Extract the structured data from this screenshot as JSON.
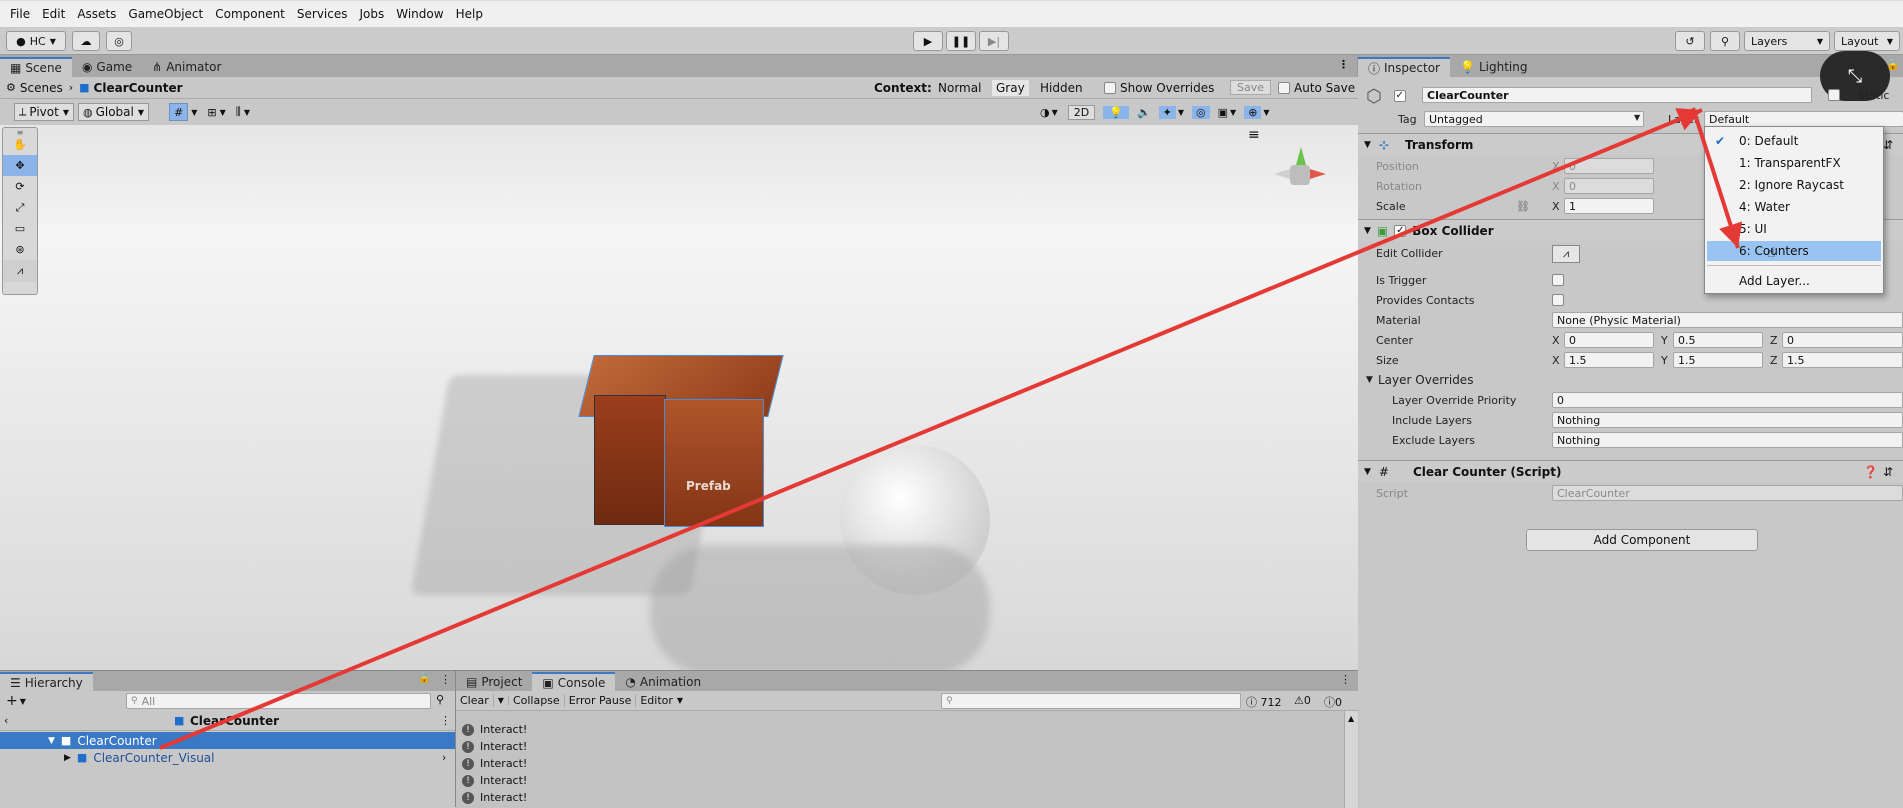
{
  "menu": [
    "File",
    "Edit",
    "Assets",
    "GameObject",
    "Component",
    "Services",
    "Jobs",
    "Window",
    "Help"
  ],
  "toolbar": {
    "account": "HC",
    "layers": "Layers",
    "layout": "Layout"
  },
  "scene_tabs": [
    "Scene",
    "Game",
    "Animator"
  ],
  "breadcrumb": {
    "root": "Scenes",
    "item": "ClearCounter"
  },
  "context_bar": {
    "label": "Context:",
    "normal": "Normal",
    "gray": "Gray",
    "hidden": "Hidden",
    "show_overrides": "Show Overrides",
    "save": "Save",
    "auto_save": "Auto Save"
  },
  "scene_toolbar": {
    "pivot": "Pivot",
    "global": "Global",
    "mode_2d": "2D"
  },
  "scene": {
    "prefab_label": "Prefab"
  },
  "inspector": {
    "tabs": [
      "Inspector",
      "Lighting"
    ],
    "object_name": "ClearCounter",
    "static_label": "Static",
    "tag_label": "Tag",
    "tag_value": "Untagged",
    "layer_label": "Layer",
    "layer_value": "Default",
    "transform": {
      "title": "Transform",
      "position": {
        "label": "Position",
        "x": "0"
      },
      "rotation": {
        "label": "Rotation",
        "x": "0"
      },
      "scale": {
        "label": "Scale",
        "x": "1"
      }
    },
    "box_collider": {
      "title": "Box Collider",
      "edit_collider": "Edit Collider",
      "is_trigger": "Is Trigger",
      "provides_contacts": "Provides Contacts",
      "material_label": "Material",
      "material_value": "None (Physic Material)",
      "center": {
        "label": "Center",
        "x": "0",
        "y": "0.5",
        "z": "0"
      },
      "size": {
        "label": "Size",
        "x": "1.5",
        "y": "1.5",
        "z": "1.5"
      },
      "layer_overrides": "Layer Overrides",
      "priority_label": "Layer Override Priority",
      "priority_value": "0",
      "include_label": "Include Layers",
      "include_value": "Nothing",
      "exclude_label": "Exclude Layers",
      "exclude_value": "Nothing"
    },
    "script_component": {
      "title": "Clear Counter (Script)",
      "script_label": "Script",
      "script_value": "ClearCounter"
    },
    "add_component": "Add Component"
  },
  "layer_dropdown": {
    "items": [
      "0: Default",
      "1: TransparentFX",
      "2: Ignore Raycast",
      "4: Water",
      "5: UI",
      "6: Counters"
    ],
    "selected_index": 5,
    "checked_index": 0,
    "add_layer": "Add Layer..."
  },
  "hierarchy": {
    "tab": "Hierarchy",
    "search_placeholder": "All",
    "header": "ClearCounter",
    "items": [
      {
        "label": "ClearCounter",
        "selected": true
      },
      {
        "label": "ClearCounter_Visual",
        "selected": false
      }
    ]
  },
  "console": {
    "tabs": [
      "Project",
      "Console",
      "Animation"
    ],
    "buttons": {
      "clear": "Clear",
      "collapse": "Collapse",
      "error_pause": "Error Pause",
      "editor": "Editor"
    },
    "counts": {
      "log": "712",
      "warn": "0",
      "error": "0"
    },
    "lines": [
      "Interact!",
      "Interact!",
      "Interact!",
      "Interact!",
      "Interact!"
    ]
  },
  "colors": {
    "selection": "#3a79c6",
    "dropdown_highlight": "#99c4f1",
    "annotation_arrow": "#e53935",
    "counter_wood": "#9b3f1d"
  }
}
